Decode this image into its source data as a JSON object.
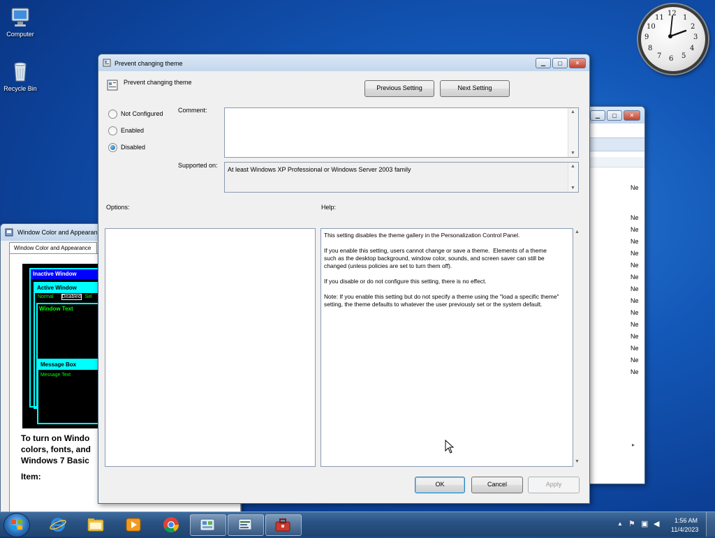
{
  "desktop": {
    "icons": [
      {
        "label": "Computer",
        "icon": "computer-icon"
      },
      {
        "label": "Recycle Bin",
        "icon": "recycle-bin-icon"
      }
    ]
  },
  "clock": {
    "numbers": [
      "12",
      "1",
      "2",
      "3",
      "4",
      "5",
      "6",
      "7",
      "8",
      "9",
      "10",
      "11"
    ]
  },
  "bg_window_left": {
    "title": "Window Color and Appearance",
    "tab": "Window Color and Appearance",
    "preview": {
      "inactive": "Inactive Window",
      "active": "Active Window",
      "normal": "Normal",
      "disabled": "Disabled",
      "selected": "Sel",
      "window_text": "Window Text",
      "message_box": "Message Box",
      "message_text": "Message Text"
    },
    "instructions": "To turn on Windo\ncolors, fonts, and\nWindows 7 Basic",
    "item_label": "Item:"
  },
  "bg_window_right": {
    "col_values": [
      "Ne",
      "Ne",
      "Ne",
      "Ne",
      "Ne",
      "Ne",
      "Ne",
      "Ne",
      "Ne",
      "Ne",
      "Ne",
      "Ne",
      "Ne",
      "Ne",
      "Ne"
    ]
  },
  "dialog": {
    "title": "Prevent changing theme",
    "setting_name": "Prevent changing theme",
    "prev_button": "Previous Setting",
    "next_button": "Next Setting",
    "options": {
      "not_configured": "Not Configured",
      "enabled": "Enabled",
      "disabled": "Disabled",
      "selected": "disabled"
    },
    "comment_label": "Comment:",
    "comment_value": "",
    "supported_label": "Supported on:",
    "supported_value": "At least Windows XP Professional or Windows Server 2003 family",
    "options_label": "Options:",
    "help_label": "Help:",
    "help_text": "This setting disables the theme gallery in the Personalization Control Panel.\n\nIf you enable this setting, users cannot change or save a theme.  Elements of a theme such as the desktop background, window color, sounds, and screen saver can still be changed (unless policies are set to turn them off).\n\nIf you disable or do not configure this setting, there is no effect.\n\nNote: If you enable this setting but do not specify a theme using the \"load a specific theme\" setting, the theme defaults to whatever the user previously set or the system default.",
    "ok_button": "OK",
    "cancel_button": "Cancel",
    "apply_button": "Apply"
  },
  "taskbar": {
    "items": [
      "internet-explorer-icon",
      "file-explorer-icon",
      "media-player-icon",
      "chrome-icon",
      "control-panel-icon",
      "group-policy-icon",
      "toolbox-icon"
    ],
    "time": "1:56 AM",
    "date": "11/4/2023"
  },
  "colors": {
    "desktop": "#1358b8",
    "preview_bg": "#000000",
    "preview_title": "#0000ff",
    "preview_active": "#00ffff",
    "preview_text": "#00ff00"
  }
}
